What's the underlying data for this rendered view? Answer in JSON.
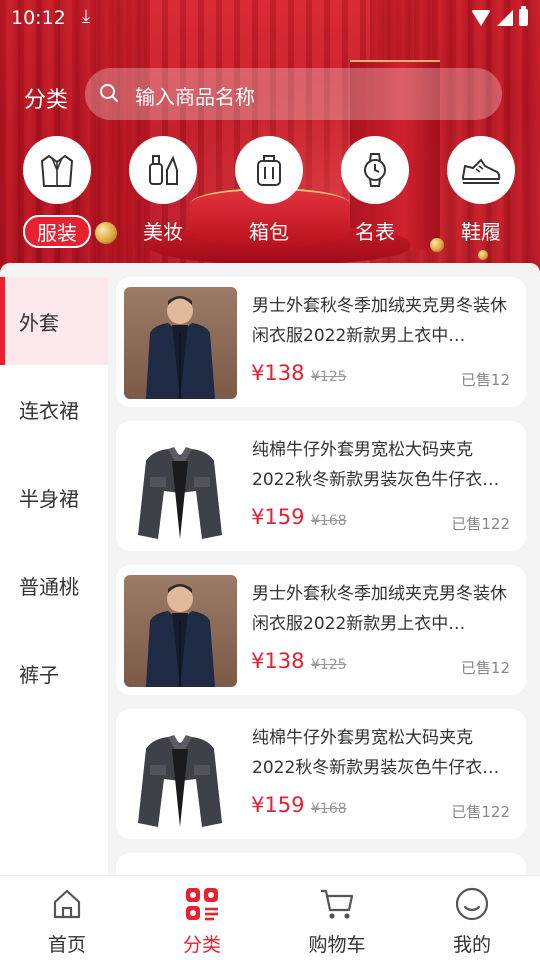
{
  "status_bar": {
    "time": "10:12"
  },
  "header": {
    "title": "分类",
    "search": {
      "placeholder": "输入商品名称"
    },
    "categories": [
      {
        "label": "服装",
        "icon": "suit-icon",
        "active": true
      },
      {
        "label": "美妆",
        "icon": "cosmetics-icon",
        "active": false
      },
      {
        "label": "箱包",
        "icon": "luggage-icon",
        "active": false
      },
      {
        "label": "名表",
        "icon": "watch-icon",
        "active": false
      },
      {
        "label": "鞋履",
        "icon": "sneaker-icon",
        "active": false
      }
    ]
  },
  "sidebar": {
    "items": [
      {
        "label": "外套",
        "active": true
      },
      {
        "label": "连衣裙",
        "active": false
      },
      {
        "label": "半身裙",
        "active": false
      },
      {
        "label": "普通桃",
        "active": false
      },
      {
        "label": "裤子",
        "active": false
      }
    ]
  },
  "products": [
    {
      "title": "男士外套秋冬季加绒夹克男冬装休闲衣服2022新款男上衣中…",
      "price": "¥138",
      "old_price": "¥125",
      "sold": "已售12",
      "image": "navy-jacket"
    },
    {
      "title": " 纯棉牛仔外套男宽松大码夹克2022秋冬新款男装灰色牛仔衣…",
      "price": "¥159",
      "old_price": "¥168",
      "sold": "已售122",
      "image": "denim-jacket"
    },
    {
      "title": "男士外套秋冬季加绒夹克男冬装休闲衣服2022新款男上衣中…",
      "price": "¥138",
      "old_price": "¥125",
      "sold": "已售12",
      "image": "navy-jacket"
    },
    {
      "title": " 纯棉牛仔外套男宽松大码夹克2022秋冬新款男装灰色牛仔衣…",
      "price": "¥159",
      "old_price": "¥168",
      "sold": "已售122",
      "image": "denim-jacket"
    }
  ],
  "bottom_nav": [
    {
      "label": "首页",
      "icon": "home-icon",
      "active": false
    },
    {
      "label": "分类",
      "icon": "category-icon",
      "active": true
    },
    {
      "label": "购物车",
      "icon": "cart-icon",
      "active": false
    },
    {
      "label": "我的",
      "icon": "profile-icon",
      "active": false
    }
  ],
  "colors": {
    "accent": "#e8202f",
    "banner": "#c21826"
  }
}
